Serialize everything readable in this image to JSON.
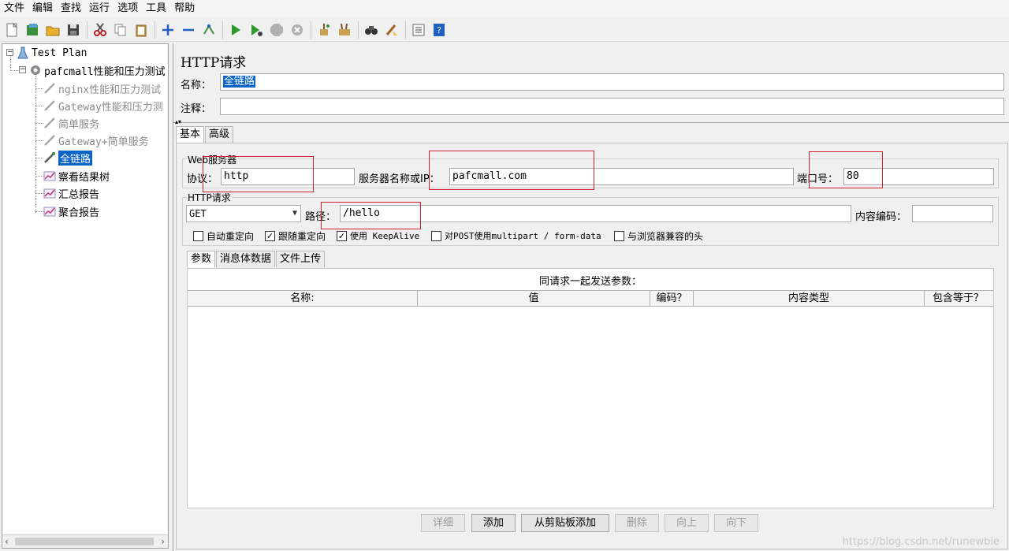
{
  "menu": [
    "文件",
    "编辑",
    "查找",
    "运行",
    "选项",
    "工具",
    "帮助"
  ],
  "toolbar_icons": [
    "new-icon",
    "templates-icon",
    "open-icon",
    "save-icon",
    "cut-icon",
    "copy-icon",
    "paste-icon",
    "expand-icon",
    "collapse-icon",
    "toggle-icon",
    "start-icon",
    "start-no-pause-icon",
    "stop-icon",
    "shutdown-icon",
    "clear-icon",
    "clear-all-icon",
    "search-icon",
    "reset-search-icon",
    "function-helper-icon",
    "help-icon"
  ],
  "tree": {
    "root": "Test Plan",
    "thread_group": "pafcmall性能和压力测试",
    "items": [
      {
        "label": "nginx性能和压力测试",
        "disabled": true
      },
      {
        "label": "Gateway性能和压力测",
        "disabled": true
      },
      {
        "label": "简单服务",
        "disabled": true
      },
      {
        "label": "Gateway+简单服务",
        "disabled": true
      },
      {
        "label": "全链路",
        "selected": true
      },
      {
        "label": "察看结果树"
      },
      {
        "label": "汇总报告"
      },
      {
        "label": "聚合报告"
      }
    ]
  },
  "panel": {
    "title": "HTTP请求",
    "name_label": "名称：",
    "name_value": "全链路",
    "comment_label": "注释：",
    "comment_value": "",
    "tabs": [
      "基本",
      "高级"
    ],
    "web_server": {
      "group_title": "Web服务器",
      "protocol_label": "协议：",
      "protocol_value": "http",
      "server_label": "服务器名称或IP：",
      "server_value": "pafcmall.com",
      "port_label": "端口号：",
      "port_value": "80"
    },
    "http_request": {
      "group_title": "HTTP请求",
      "method": "GET",
      "path_label": "路径：",
      "path_value": "/hello",
      "encoding_label": "内容编码：",
      "encoding_value": ""
    },
    "checkboxes": [
      {
        "label": "自动重定向",
        "checked": false
      },
      {
        "label": "跟随重定向",
        "checked": true
      },
      {
        "label": "使用 KeepAlive",
        "checked": true
      },
      {
        "label": "对POST使用multipart / form-data",
        "checked": false
      },
      {
        "label": "与浏览器兼容的头",
        "checked": false
      }
    ],
    "sub_tabs": [
      "参数",
      "消息体数据",
      "文件上传"
    ],
    "params_caption": "同请求一起发送参数：",
    "params_columns": [
      "名称:",
      "值",
      "编码？",
      "内容类型",
      "包含等于？"
    ],
    "buttons": [
      {
        "label": "详细",
        "enabled": false
      },
      {
        "label": "添加",
        "enabled": true
      },
      {
        "label": "从剪贴板添加",
        "enabled": true
      },
      {
        "label": "删除",
        "enabled": false
      },
      {
        "label": "向上",
        "enabled": false
      },
      {
        "label": "向下",
        "enabled": false
      }
    ]
  },
  "watermark": "https://blog.csdn.net/runewbie",
  "colors": {
    "selection": "#0a64c8",
    "annotation": "#d0202a"
  }
}
